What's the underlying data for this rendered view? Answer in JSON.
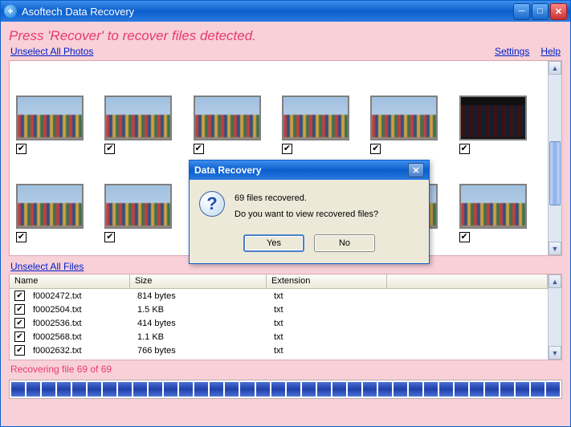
{
  "titlebar": {
    "app_title": "Asoftech Data Recovery"
  },
  "hint": "Press 'Recover' to recover files detected.",
  "links": {
    "unselect_photos": "Unselect All Photos",
    "unselect_files": "Unselect All Files",
    "settings": "Settings",
    "help": "Help"
  },
  "photos": [
    {
      "checked": true
    },
    {
      "checked": true
    },
    {
      "checked": true
    },
    {
      "checked": true
    },
    {
      "checked": true
    },
    {
      "checked": true,
      "dark": true
    },
    {
      "checked": true
    },
    {
      "checked": true
    },
    {
      "checked": true,
      "hidden_under_dialog": true
    },
    {
      "checked": true,
      "hidden_under_dialog": true
    },
    {
      "checked": true
    },
    {
      "checked": true
    },
    {
      "checked": false,
      "dark": true,
      "partial": true
    }
  ],
  "files": {
    "columns": {
      "name": "Name",
      "size": "Size",
      "ext": "Extension"
    },
    "rows": [
      {
        "checked": true,
        "name": "f0002472.txt",
        "size": "814 bytes",
        "ext": "txt"
      },
      {
        "checked": true,
        "name": "f0002504.txt",
        "size": "1.5 KB",
        "ext": "txt"
      },
      {
        "checked": true,
        "name": "f0002536.txt",
        "size": "414 bytes",
        "ext": "txt"
      },
      {
        "checked": true,
        "name": "f0002568.txt",
        "size": "1.1 KB",
        "ext": "txt"
      },
      {
        "checked": true,
        "name": "f0002632.txt",
        "size": "766 bytes",
        "ext": "txt"
      }
    ]
  },
  "status": "Recovering file 69 of 69",
  "progress_segments": 36,
  "dialog": {
    "title": "Data Recovery",
    "line1": "69 files recovered.",
    "line2": "Do you want to view recovered files?",
    "yes": "Yes",
    "no": "No"
  }
}
